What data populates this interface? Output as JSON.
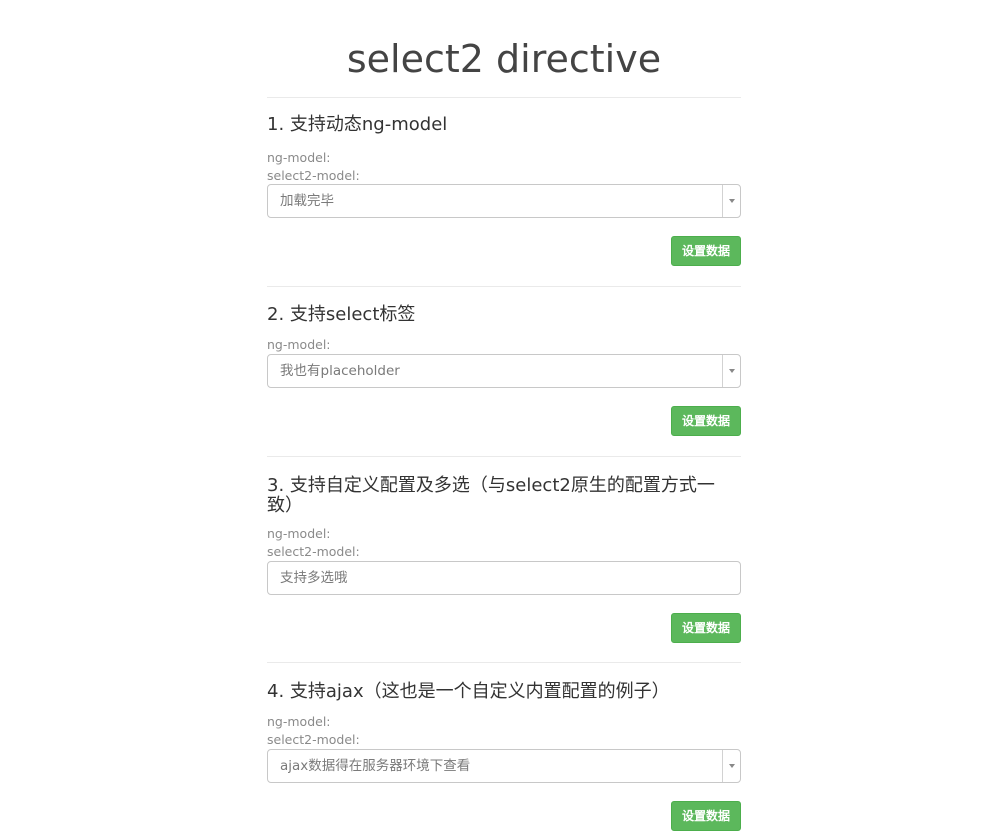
{
  "page": {
    "title": "select2 directive"
  },
  "sections": [
    {
      "heading": "1. 支持动态ng-model",
      "ng_model_label": "ng-model:",
      "select2_model_label": "select2-model:",
      "select_value": "加载完毕",
      "button_label": "设置数据"
    },
    {
      "heading": "2. 支持select标签",
      "ng_model_label": "ng-model:",
      "select_value": "我也有placeholder",
      "button_label": "设置数据"
    },
    {
      "heading_line1": "3. 支持自定义配置及多选（与select2原生的配置方式一",
      "heading_line2": "致）",
      "ng_model_label": "ng-model:",
      "select2_model_label": "select2-model:",
      "select_placeholder": "支持多选哦",
      "button_label": "设置数据"
    },
    {
      "heading": "4. 支持ajax（这也是一个自定义内置配置的例子）",
      "ng_model_label": "ng-model:",
      "select2_model_label": "select2-model:",
      "select_value": "ajax数据得在服务器环境下查看",
      "button_label": "设置数据"
    }
  ],
  "colors": {
    "button_bg": "#5cb85c",
    "text": "#444444",
    "muted": "#8a8a8a"
  },
  "icons": {
    "dropdown": "chevron-down-icon"
  }
}
